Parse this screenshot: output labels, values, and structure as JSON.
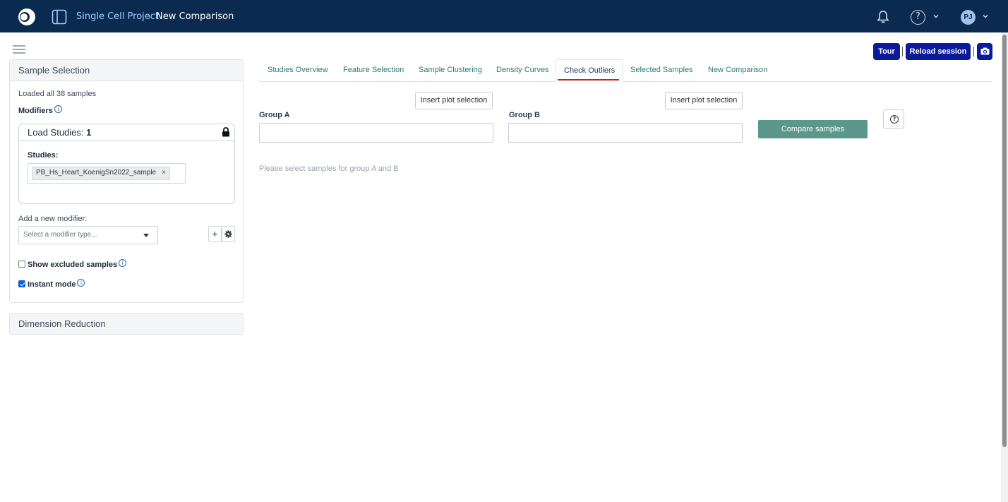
{
  "header": {
    "project": "Single Cell Project",
    "separator": "›",
    "page": "New Comparison",
    "avatar_initials": "PJ",
    "help_glyph": "?"
  },
  "actions": {
    "tour": "Tour",
    "reload": "Reload session"
  },
  "sidebar": {
    "sample_selection": {
      "title": "Sample Selection",
      "loaded_text": "Loaded all 38 samples",
      "modifiers_label": "Modifiers",
      "load_studies": {
        "title": "Load Studies:",
        "count": "1",
        "studies_label": "Studies:",
        "chips": [
          "PB_Hs_Heart_KoenigSn2022_sample"
        ],
        "chip_remove": "×"
      },
      "add_modifier_label": "Add a new modifier:",
      "modifier_placeholder": "Select a modifier type...",
      "show_excluded": {
        "label": "Show excluded samples",
        "checked": false
      },
      "instant_mode": {
        "label": "Instant mode",
        "checked": true
      }
    },
    "dimension_reduction": {
      "title": "Dimension Reduction"
    }
  },
  "tabs": [
    {
      "label": "Studies Overview",
      "active": false
    },
    {
      "label": "Feature Selection",
      "active": false
    },
    {
      "label": "Sample Clustering",
      "active": false
    },
    {
      "label": "Density Curves",
      "active": false
    },
    {
      "label": "Check Outliers",
      "active": true
    },
    {
      "label": "Selected Samples",
      "active": false
    },
    {
      "label": "New Comparison",
      "active": false
    }
  ],
  "comparison": {
    "insert_selection": "Insert plot selection",
    "group_a_label": "Group A",
    "group_b_label": "Group B",
    "group_a_value": "",
    "group_b_value": "",
    "compare_button": "Compare samples",
    "hint": "Please select samples for group A and B"
  },
  "colors": {
    "navbar": "#0b2a4f",
    "primary_button": "#0a1a9a",
    "compare_button": "#5b978b",
    "active_tab_underline": "#cc1f1f",
    "tab_text": "#2b7a78"
  }
}
